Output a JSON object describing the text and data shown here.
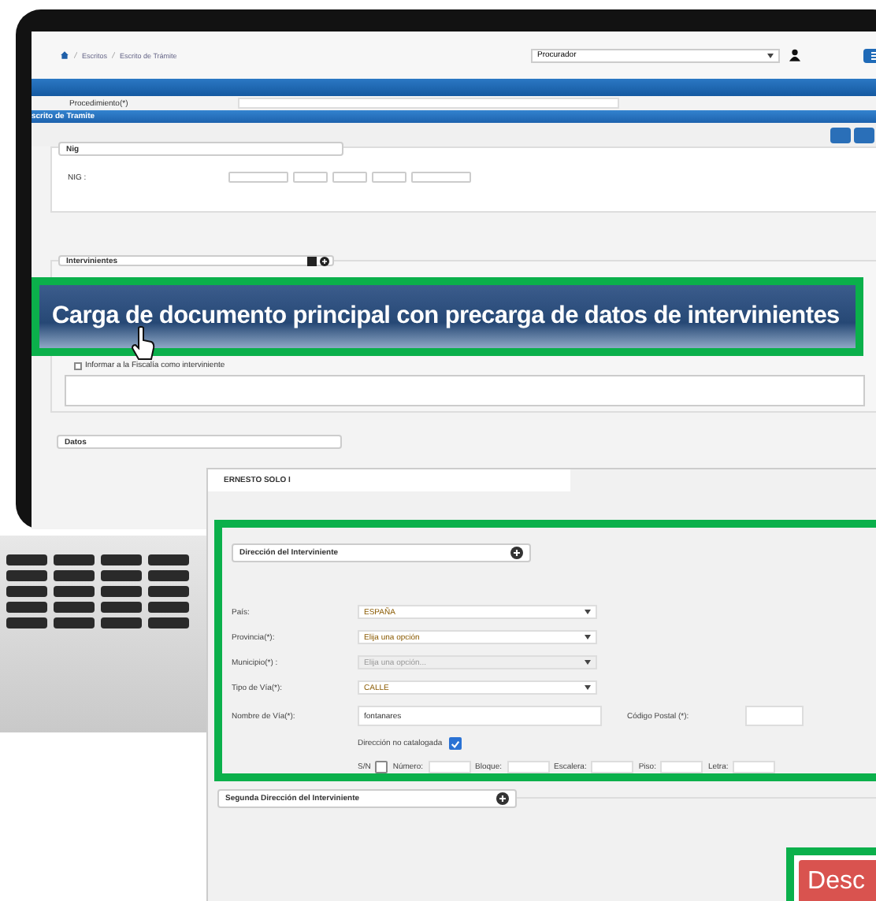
{
  "breadcrumb": [
    "Escritos",
    "Escrito de Trámite"
  ],
  "user_select": {
    "value": "Procurador"
  },
  "procedimiento_label": "Procedimiento(*)",
  "form_title": "scrito de Tramite",
  "nig_section": {
    "title": "Nig",
    "label": "NIG :"
  },
  "intervinientes": {
    "title": "Intervinientes",
    "checkbox_label": "Informar a la Fiscalía como interviniente",
    "checked": false
  },
  "datos_title": "Datos",
  "callout": "Carga de documento principal con precarga de datos de intervinientes",
  "detail": {
    "name": "ERNESTO SOLO I",
    "address_title": "Dirección del Interviniente",
    "fields": [
      {
        "label": "País:",
        "value": "ESPAÑA",
        "disabled": false
      },
      {
        "label": "Provincia(*):",
        "value": "Elija una opción",
        "disabled": false
      },
      {
        "label": "Municipio(*) :",
        "placeholder": "Elija una opción...",
        "disabled": true
      },
      {
        "label": "Tipo de Vía(*):",
        "value": "CALLE",
        "disabled": false
      }
    ],
    "street": {
      "label": "Nombre de Vía(*):",
      "value": "fontanares"
    },
    "postal": {
      "label": "Código Postal (*):"
    },
    "uncatalogued": {
      "label": "Dirección no catalogada",
      "checked": true
    },
    "sn": {
      "label": "S/N",
      "checked": false
    },
    "number_fields": [
      "Número:",
      "Bloque:",
      "Escalera:",
      "Piso:",
      "Letra:"
    ],
    "second_address_title": "Segunda Dirección del Interviniente",
    "discard_button": "Desc"
  }
}
